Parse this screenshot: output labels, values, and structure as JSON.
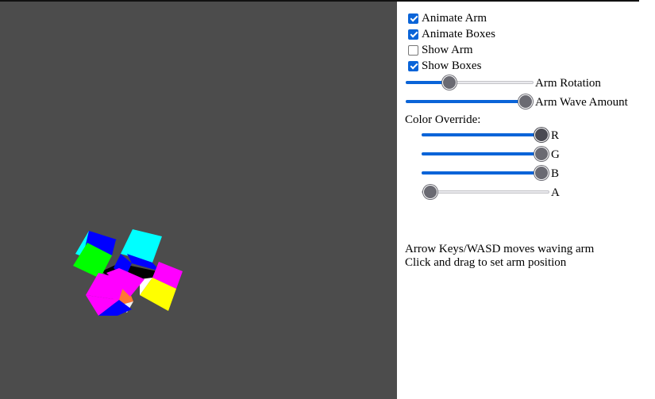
{
  "controls": {
    "checkboxes": [
      {
        "label": "Animate Arm",
        "checked": true
      },
      {
        "label": "Animate Boxes",
        "checked": true
      },
      {
        "label": "Show Arm",
        "checked": false
      },
      {
        "label": "Show Boxes",
        "checked": true
      }
    ],
    "arm_rotation": {
      "label": "Arm Rotation",
      "value": 0.35
    },
    "arm_wave_amount": {
      "label": "Arm Wave Amount",
      "value": 1.0
    },
    "color_override": {
      "label": "Color Override:",
      "channels": [
        {
          "label": "R",
          "value": 1.0
        },
        {
          "label": "G",
          "value": 1.0
        },
        {
          "label": "B",
          "value": 1.0
        },
        {
          "label": "A",
          "value": 0.0
        }
      ]
    }
  },
  "instructions": {
    "line1": "Arrow Keys/WASD moves waving arm",
    "line2": "Click and drag to set arm position"
  },
  "colors": {
    "viewport_bg": "#4c4c4c",
    "slider_accent": "#0a64d8",
    "cube_colors": [
      "#ff00ff",
      "#00ffff",
      "#ffff00",
      "#0000ff",
      "#00ff00",
      "#ffffff",
      "#ff3300"
    ]
  }
}
